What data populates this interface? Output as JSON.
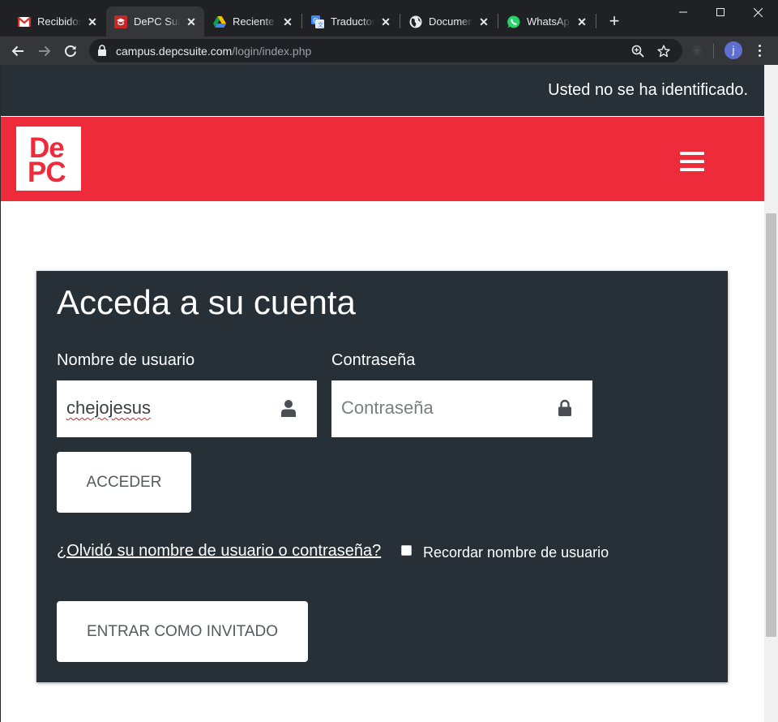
{
  "browser": {
    "tabs": [
      {
        "title": "Recibidos (",
        "icon": "gmail-icon",
        "active": false
      },
      {
        "title": "DePC Suite",
        "icon": "depc-icon",
        "active": true
      },
      {
        "title": "Reciente -",
        "icon": "drive-icon",
        "active": false
      },
      {
        "title": "Traductor d",
        "icon": "translate-icon",
        "active": false
      },
      {
        "title": "Document",
        "icon": "globe-icon",
        "active": false
      },
      {
        "title": "WhatsApp",
        "icon": "whatsapp-icon",
        "active": false
      }
    ],
    "close_glyph": "✕",
    "new_tab_glyph": "+",
    "url_host": "campus.depcsuite.com",
    "url_path": "/login/index.php",
    "profile_initial": "j"
  },
  "header": {
    "login_status": "Usted no se ha identificado."
  },
  "brand": {
    "logo_line1": "De",
    "logo_line2": "PC",
    "color": "#ee2b3b",
    "dark": "#263036"
  },
  "login": {
    "title": "Acceda a su cuenta",
    "username_label": "Nombre de usuario",
    "username_value": "chejojesus",
    "password_label": "Contraseña",
    "password_placeholder": "Contraseña",
    "submit_label": "ACCEDER",
    "forgot_link": "¿Olvidó su nombre de usuario o contraseña?",
    "remember_label": "Recordar nombre de usuario",
    "remember_checked": false,
    "guest_label": "ENTRAR COMO INVITADO"
  }
}
